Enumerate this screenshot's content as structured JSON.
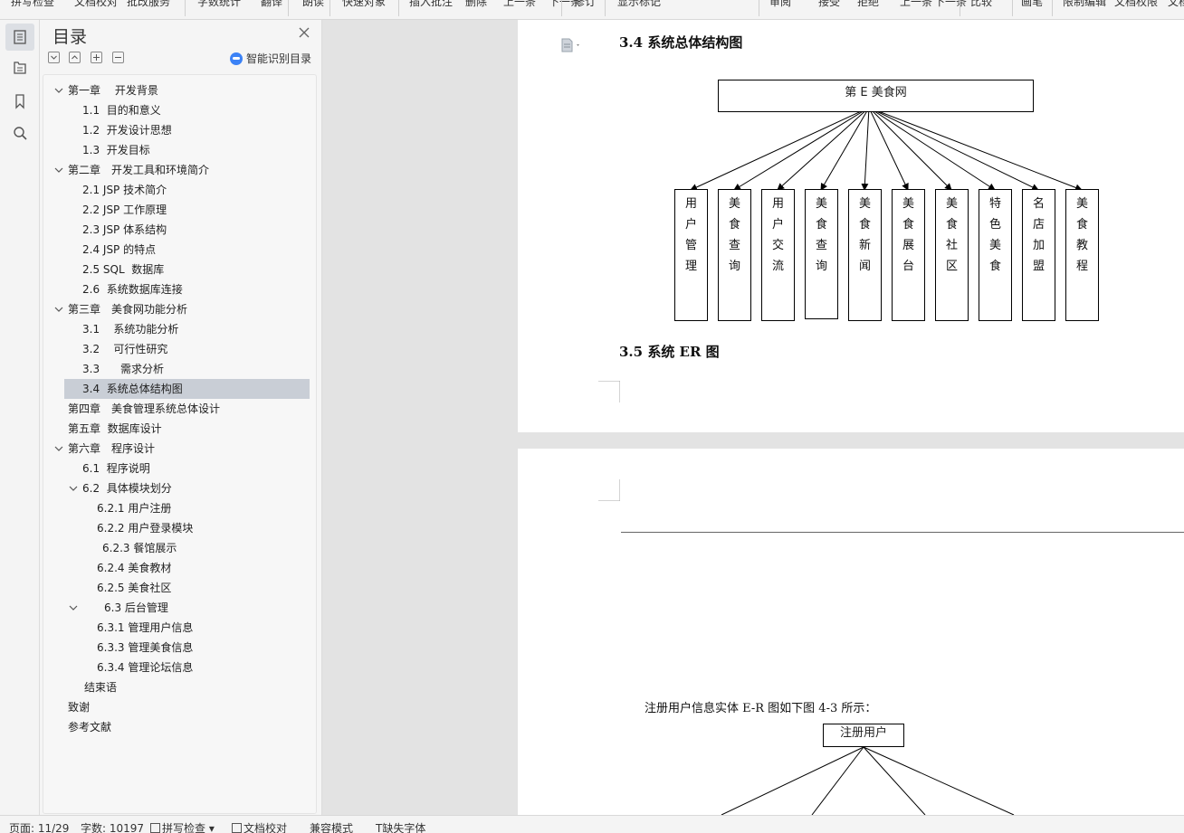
{
  "toolbar": {
    "items": [
      "拼写检查",
      "文档校对",
      "批改服务",
      "字数统计",
      "翻译",
      "朗读",
      "快速对象",
      "插入批注",
      "删除",
      "上一条",
      "下一条",
      "修订",
      "显示标记",
      "审阅",
      "接受",
      "拒绝",
      "上一条",
      "下一条",
      "比较",
      "画笔",
      "限制编辑",
      "文档权限",
      "文档加密"
    ]
  },
  "rail": {
    "icons": [
      "toc-icon",
      "navigation-icon",
      "bookmark-icon",
      "search-icon"
    ]
  },
  "toc": {
    "title": "目录",
    "smart_label": "智能识别目录",
    "controls": [
      "collapse-all-icon",
      "expand-all-icon",
      "add-icon",
      "remove-icon"
    ],
    "items": [
      {
        "label": "第一章　 开发背景",
        "caret": "down"
      },
      {
        "label": "1.1  目的和意义"
      },
      {
        "label": "1.2  开发设计思想"
      },
      {
        "label": "1.3  开发目标"
      },
      {
        "label": "第二章　开发工具和环境简介",
        "caret": "down"
      },
      {
        "label": "2.1 JSP 技术简介"
      },
      {
        "label": "2.2 JSP 工作原理"
      },
      {
        "label": "2.3 JSP 体系结构"
      },
      {
        "label": "2.4 JSP 的特点"
      },
      {
        "label": "2.5 SQL  数据库"
      },
      {
        "label": "2.6  系统数据库连接"
      },
      {
        "label": "第三章　美食网功能分析",
        "caret": "down"
      },
      {
        "label": "3.1    系统功能分析"
      },
      {
        "label": "3.2    可行性研究"
      },
      {
        "label": "3.3      需求分析"
      },
      {
        "label": "3.4  系统总体结构图",
        "selected": true
      },
      {
        "label": "第四章　美食管理系统总体设计"
      },
      {
        "label": "第五章  数据库设计"
      },
      {
        "label": "第六章　程序设计",
        "caret": "down"
      },
      {
        "label": "6.1  程序说明"
      },
      {
        "label": "6.2  具体模块划分",
        "caret": "down"
      },
      {
        "label": "6.2.1 用户注册"
      },
      {
        "label": "6.2.2 用户登录模块"
      },
      {
        "label": "6.2.3 餐馆展示"
      },
      {
        "label": "6.2.4 美食教材"
      },
      {
        "label": "6.2.5 美食社区"
      },
      {
        "label": "6.3 后台管理",
        "caret": "down"
      },
      {
        "label": "6.3.1 管理用户信息"
      },
      {
        "label": "6.3.3 管理美食信息"
      },
      {
        "label": "6.3.4 管理论坛信息"
      },
      {
        "label": "结束语"
      },
      {
        "label": "致谢"
      },
      {
        "label": "参考文献"
      }
    ]
  },
  "document": {
    "heading_34": "3.4  系统总体结构图",
    "heading_35": "3.5 系统 ER 图",
    "root_box": "第 E 美食网",
    "modules": [
      "用户管理",
      "美食查询",
      "用户交流",
      "美食查询",
      "美食新闻",
      "美食展台",
      "美食社区",
      "特色美食",
      "名店加盟",
      "美食教程"
    ],
    "caption": "注册用户信息实体 E-R 图如下图 4-3 所示：",
    "er_box": "注册用户"
  },
  "status": {
    "page": "页面: 11/29",
    "words": "字数: 10197",
    "spell": "拼写检查",
    "proof": "文档校对",
    "compat": "兼容模式",
    "missing_font": "缺失字体"
  }
}
